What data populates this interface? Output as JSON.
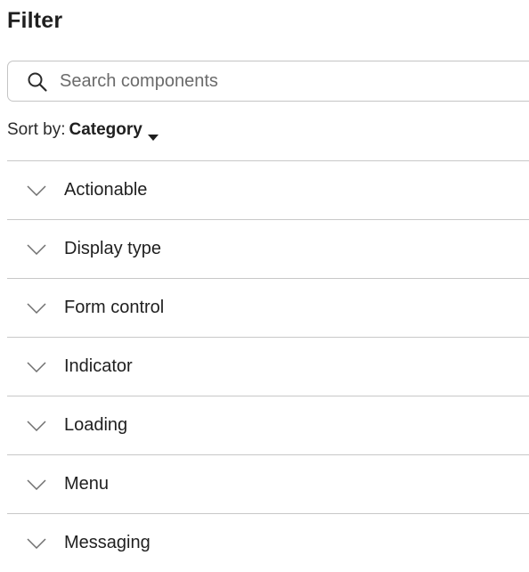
{
  "panel": {
    "title": "Filter"
  },
  "search": {
    "placeholder": "Search components",
    "value": ""
  },
  "sort": {
    "label": "Sort by:",
    "value": "Category"
  },
  "categories": [
    {
      "label": "Actionable"
    },
    {
      "label": "Display type"
    },
    {
      "label": "Form control"
    },
    {
      "label": "Indicator"
    },
    {
      "label": "Loading"
    },
    {
      "label": "Menu"
    },
    {
      "label": "Messaging"
    }
  ],
  "icons": {
    "search": "search-icon",
    "sort_caret": "caret-down-icon",
    "category_toggle": "chevron-down-icon"
  },
  "colors": {
    "text": "#1f1f1f",
    "border": "#c8c8c8",
    "placeholder": "#6b6b6b"
  }
}
